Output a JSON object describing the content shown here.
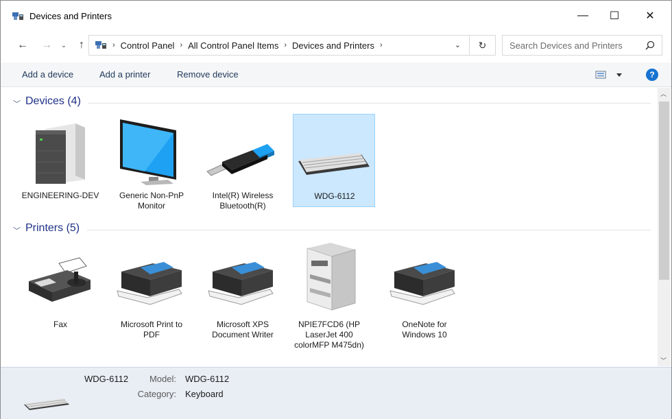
{
  "window": {
    "title": "Devices and Printers",
    "minimize": "—",
    "maximize": "☐",
    "close": "✕"
  },
  "nav": {
    "back": "←",
    "forward": "→",
    "recent": "⌄",
    "up": "↑",
    "breadcrumb": [
      "Control Panel",
      "All Control Panel Items",
      "Devices and Printers"
    ],
    "separator": "›",
    "dropdown": "⌄",
    "refresh": "↻",
    "search_placeholder": "Search Devices and Printers"
  },
  "commands": {
    "add_device": "Add a device",
    "add_printer": "Add a printer",
    "remove_device": "Remove device",
    "help": "?"
  },
  "groups": {
    "devices": {
      "title": "Devices (4)",
      "items": [
        {
          "label": "ENGINEERING-DEV",
          "icon": "computer-tower-icon"
        },
        {
          "label": "Generic Non-PnP Monitor",
          "icon": "monitor-icon"
        },
        {
          "label": "Intel(R) Wireless Bluetooth(R)",
          "icon": "usb-dongle-icon"
        },
        {
          "label": "WDG-6112",
          "icon": "keyboard-icon",
          "selected": true
        }
      ]
    },
    "printers": {
      "title": "Printers (5)",
      "items": [
        {
          "label": "Fax",
          "icon": "fax-icon"
        },
        {
          "label": "Microsoft Print to PDF",
          "icon": "printer-icon"
        },
        {
          "label": "Microsoft XPS Document Writer",
          "icon": "printer-icon"
        },
        {
          "label": "NPIE7FCD6 (HP LaserJet 400 colorMFP M475dn)",
          "icon": "mfp-printer-icon"
        },
        {
          "label": "OneNote for Windows 10",
          "icon": "printer-icon"
        }
      ]
    }
  },
  "details": {
    "name": "WDG-6112",
    "model_label": "Model:",
    "model_value": "WDG-6112",
    "category_label": "Category:",
    "category_value": "Keyboard"
  },
  "colors": {
    "accent": "#1e3287",
    "selection": "#cce8ff",
    "details_bg": "#e9eef5"
  }
}
